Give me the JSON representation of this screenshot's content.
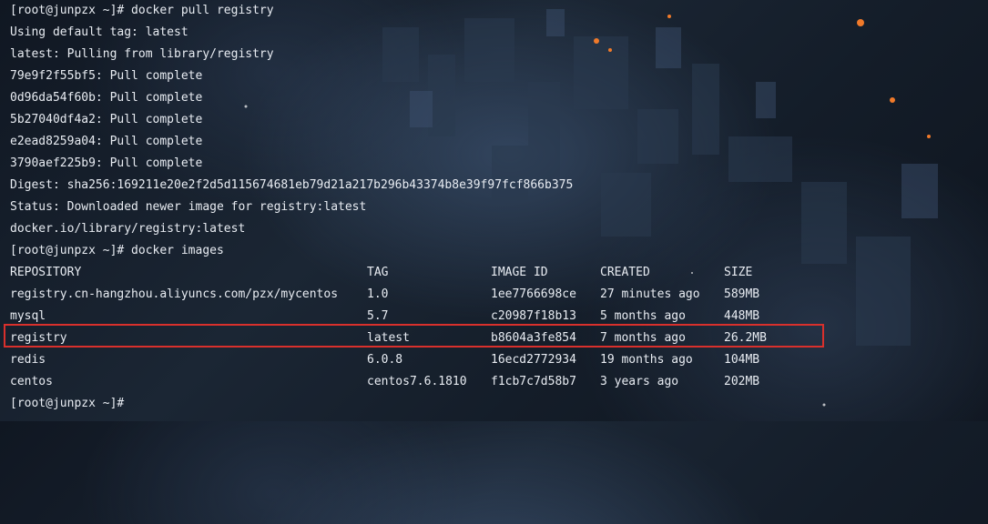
{
  "terminal": {
    "lines": [
      "[root@junpzx ~]# docker pull registry",
      "Using default tag: latest",
      "latest: Pulling from library/registry",
      "79e9f2f55bf5: Pull complete",
      "0d96da54f60b: Pull complete",
      "5b27040df4a2: Pull complete",
      "e2ead8259a04: Pull complete",
      "3790aef225b9: Pull complete",
      "Digest: sha256:169211e20e2f2d5d115674681eb79d21a217b296b43374b8e39f97fcf866b375",
      "Status: Downloaded newer image for registry:latest",
      "docker.io/library/registry:latest",
      "[root@junpzx ~]# docker images"
    ],
    "images_table": {
      "headers": [
        "REPOSITORY",
        "TAG",
        "IMAGE ID",
        "CREATED",
        "SIZE"
      ],
      "rows": [
        [
          "registry.cn-hangzhou.aliyuncs.com/pzx/mycentos",
          "1.0",
          "1ee7766698ce",
          "27 minutes ago",
          "589MB"
        ],
        [
          "mysql",
          "5.7",
          "c20987f18b13",
          "5 months ago",
          "448MB"
        ],
        [
          "registry",
          "latest",
          "b8604a3fe854",
          "7 months ago",
          "26.2MB"
        ],
        [
          "redis",
          "6.0.8",
          "16ecd2772934",
          "19 months ago",
          "104MB"
        ],
        [
          "centos",
          "centos7.6.1810",
          "f1cb7c7d58b7",
          "3 years ago",
          "202MB"
        ]
      ]
    },
    "prompt": "[root@junpzx ~]#",
    "highlight_color": "#d9302c"
  }
}
